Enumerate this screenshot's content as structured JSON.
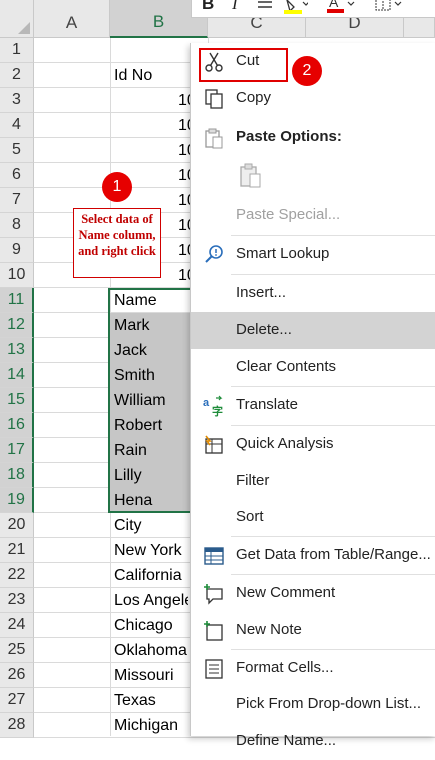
{
  "toolbar": {
    "bold": "B",
    "italic": "I",
    "fill_color": "#ffff00",
    "font_color": "#e00000"
  },
  "columns": [
    "A",
    "B",
    "C",
    "D"
  ],
  "rows": [
    "1",
    "2",
    "3",
    "4",
    "5",
    "6",
    "7",
    "8",
    "9",
    "10",
    "11",
    "12",
    "13",
    "14",
    "15",
    "16",
    "17",
    "18",
    "19",
    "20",
    "21",
    "22",
    "23",
    "24",
    "25",
    "26",
    "27",
    "28"
  ],
  "cells_b": [
    "",
    "Id No",
    "",
    "",
    "",
    "",
    "",
    "",
    "",
    "",
    "Name",
    "Mark",
    "Jack",
    "Smith",
    "William",
    "Robert",
    "Rain",
    "Lilly",
    "Hena",
    "City",
    "New York",
    "California",
    "Los Angeles",
    "Chicago",
    "Oklahoma",
    "Missouri",
    "Texas",
    "Michigan"
  ],
  "cells_c": [
    "",
    "",
    "10",
    "10",
    "10",
    "10",
    "10",
    "10",
    "10",
    "10",
    "",
    "",
    "",
    "",
    "",
    "",
    "",
    "",
    "",
    "",
    "",
    "",
    "",
    "",
    "",
    "",
    "",
    ""
  ],
  "annotation": {
    "note": "Select data of Name column, and right click",
    "badge1": "1",
    "badge2": "2"
  },
  "menu": {
    "items": [
      {
        "label": "Cut",
        "icon": "scissors-icon"
      },
      {
        "label": "Copy",
        "icon": "copy-icon"
      },
      {
        "label": "Paste Options:",
        "icon": "clipboard-icon"
      },
      {
        "label": "",
        "icon": "paste-icon"
      },
      {
        "label": "Paste Special...",
        "icon": ""
      },
      {
        "label": "Smart Lookup",
        "icon": "smart-lookup-icon"
      },
      {
        "label": "Insert...",
        "icon": ""
      },
      {
        "label": "Delete...",
        "icon": ""
      },
      {
        "label": "Clear Contents",
        "icon": ""
      },
      {
        "label": "Translate",
        "icon": "translate-icon"
      },
      {
        "label": "Quick Analysis",
        "icon": "quick-analysis-icon"
      },
      {
        "label": "Filter",
        "icon": ""
      },
      {
        "label": "Sort",
        "icon": ""
      },
      {
        "label": "Get Data from Table/Range...",
        "icon": "table-icon"
      },
      {
        "label": "New Comment",
        "icon": "new-comment-icon"
      },
      {
        "label": "New Note",
        "icon": "new-note-icon"
      },
      {
        "label": "Format Cells...",
        "icon": "format-cells-icon"
      },
      {
        "label": "Pick From Drop-down List...",
        "icon": ""
      },
      {
        "label": "Define Name...",
        "icon": ""
      }
    ]
  },
  "colors": {
    "selection": "#217346",
    "highlight_red": "#e00000"
  }
}
